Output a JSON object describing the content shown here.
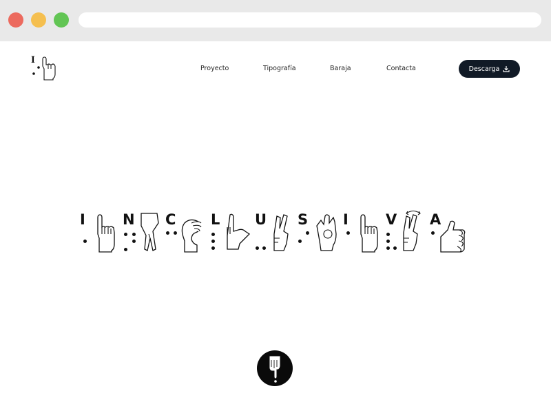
{
  "browser": {
    "controls": [
      "close",
      "minimize",
      "maximize"
    ],
    "url": ""
  },
  "header": {
    "logo": {
      "letter": "I",
      "icon": "pointing-hand-icon"
    },
    "nav": [
      {
        "label": "Proyecto"
      },
      {
        "label": "Tipografía"
      },
      {
        "label": "Baraja"
      },
      {
        "label": "Contacta"
      }
    ],
    "download": {
      "label": "Descarga",
      "icon": "download-icon"
    }
  },
  "hero": {
    "letters": [
      "I",
      "N",
      "C",
      "L",
      "U",
      "S",
      "I",
      "V",
      "A"
    ]
  },
  "scroll_button": {
    "icon": "hand-pointing-down-icon"
  }
}
